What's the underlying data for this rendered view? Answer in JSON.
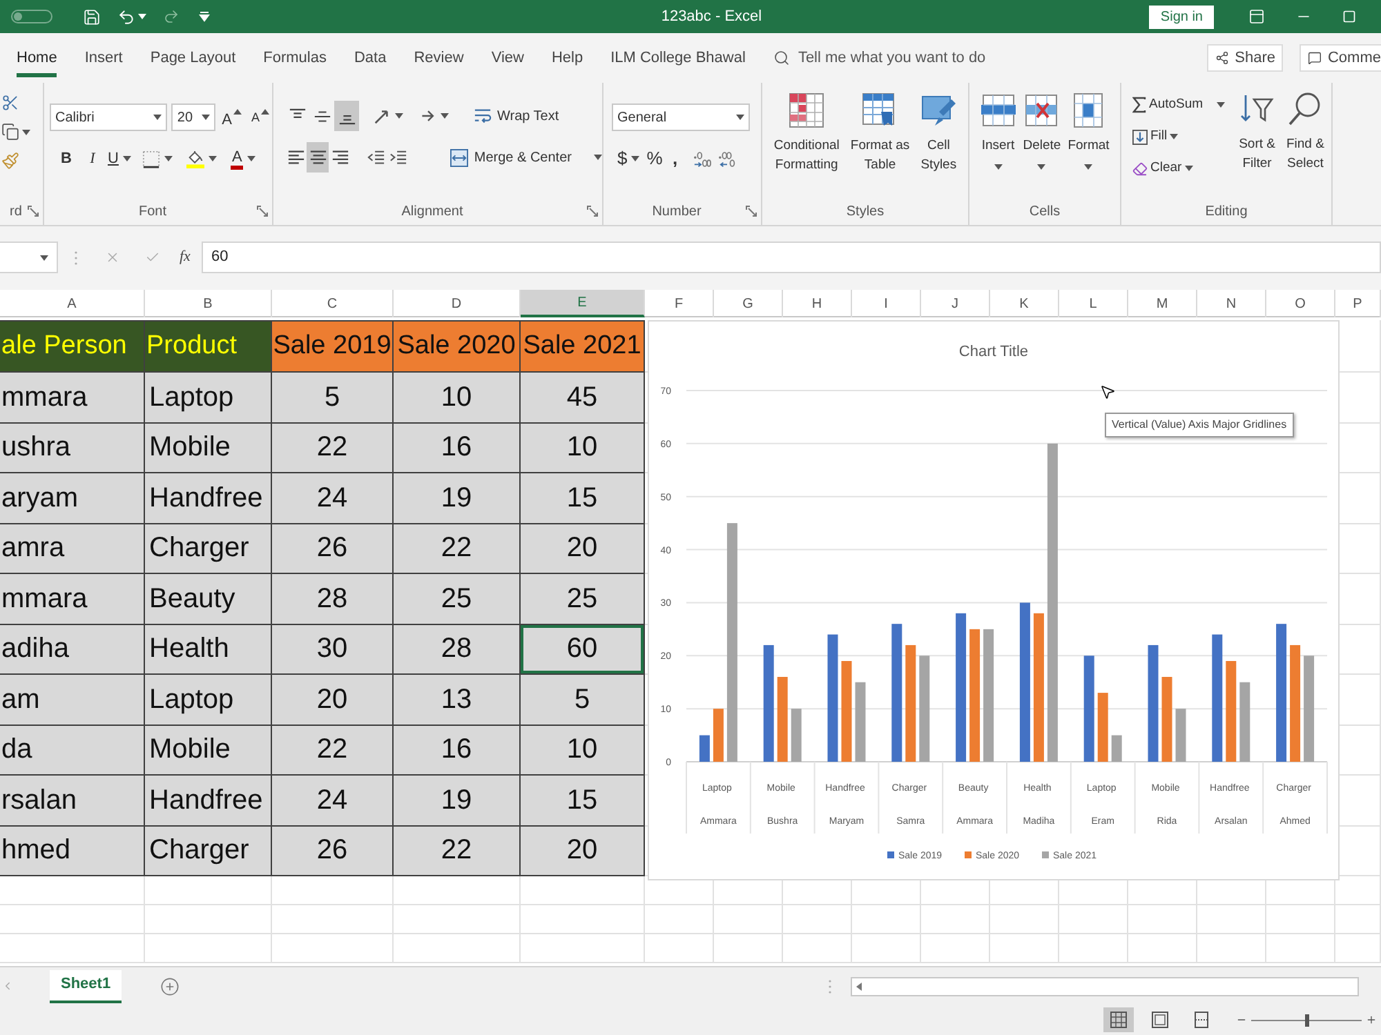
{
  "title_bar": {
    "title": "123abc - Excel",
    "sign_in": "Sign in"
  },
  "tabs": [
    {
      "label": "Home",
      "selected": true
    },
    {
      "label": "Insert",
      "selected": false
    },
    {
      "label": "Page Layout",
      "selected": false
    },
    {
      "label": "Formulas",
      "selected": false
    },
    {
      "label": "Data",
      "selected": false
    },
    {
      "label": "Review",
      "selected": false
    },
    {
      "label": "View",
      "selected": false
    },
    {
      "label": "Help",
      "selected": false
    },
    {
      "label": "ILM College Bhawal",
      "selected": false
    }
  ],
  "tell_me": {
    "placeholder": "Tell me what you want to do"
  },
  "share": "Share",
  "comments": "Comme",
  "ribbon": {
    "clipboard": {
      "label": "rd"
    },
    "font": {
      "label": "Font",
      "font_name": "Calibri",
      "font_size": "20",
      "grow": "A",
      "shrink": "A",
      "bold": "B",
      "italic": "I",
      "underline": "U",
      "font_color": "A"
    },
    "alignment": {
      "label": "Alignment",
      "vertical": [
        {
          "kind": "top",
          "selected": false
        },
        {
          "kind": "middle",
          "selected": false
        },
        {
          "kind": "bottom",
          "selected": true
        }
      ],
      "horizontal": [
        {
          "kind": "left",
          "selected": false
        },
        {
          "kind": "center",
          "selected": true
        },
        {
          "kind": "right",
          "selected": false
        }
      ],
      "wrap_text": "Wrap Text",
      "merge": "Merge & Center"
    },
    "number": {
      "label": "Number",
      "format": "General",
      "currency": "$",
      "percent": "%",
      "comma": ","
    },
    "styles": {
      "label": "Styles",
      "buttons": [
        {
          "kind": "conditional",
          "lines": [
            "Conditional",
            "Formatting"
          ]
        },
        {
          "kind": "table",
          "lines": [
            "Format as",
            "Table"
          ]
        },
        {
          "kind": "cell_styles",
          "lines": [
            "Cell",
            "Styles"
          ]
        }
      ]
    },
    "cells": {
      "label": "Cells",
      "buttons": [
        {
          "kind": "insert",
          "label": "Insert"
        },
        {
          "kind": "delete",
          "label": "Delete"
        },
        {
          "kind": "format",
          "label": "Format"
        }
      ]
    },
    "editing": {
      "label": "Editing",
      "autosum": "AutoSum",
      "fill": "Fill",
      "clear": "Clear",
      "sort": [
        "Sort &",
        "Filter"
      ],
      "find": [
        "Find &",
        "Select"
      ]
    }
  },
  "formula_bar": {
    "function_label": "fx",
    "value": "60"
  },
  "columns": [
    {
      "label": "A",
      "selected": false
    },
    {
      "label": "B",
      "selected": false
    },
    {
      "label": "C",
      "selected": false
    },
    {
      "label": "D",
      "selected": false
    },
    {
      "label": "E",
      "selected": true
    },
    {
      "label": "F",
      "selected": false
    },
    {
      "label": "G",
      "selected": false
    },
    {
      "label": "H",
      "selected": false
    },
    {
      "label": "I",
      "selected": false
    },
    {
      "label": "J",
      "selected": false
    },
    {
      "label": "K",
      "selected": false
    },
    {
      "label": "L",
      "selected": false
    },
    {
      "label": "M",
      "selected": false
    },
    {
      "label": "N",
      "selected": false
    },
    {
      "label": "O",
      "selected": false
    },
    {
      "label": "P",
      "selected": false
    }
  ],
  "table": {
    "header": [
      {
        "text": "ale Person",
        "color": "#375623"
      },
      {
        "text": "Product",
        "color": "#375623"
      },
      {
        "text": "Sale 2019",
        "color": "#ed7d31"
      },
      {
        "text": "Sale 2020",
        "color": "#ed7d31"
      },
      {
        "text": "Sale 2021",
        "color": "#ed7d31"
      }
    ],
    "rows": [
      {
        "cells": [
          {
            "text": "mmara",
            "selected": false
          },
          {
            "text": "Laptop",
            "selected": false
          },
          {
            "text": "5",
            "selected": false
          },
          {
            "text": "10",
            "selected": false
          },
          {
            "text": "45",
            "selected": false
          }
        ]
      },
      {
        "cells": [
          {
            "text": "ushra",
            "selected": false
          },
          {
            "text": "Mobile",
            "selected": false
          },
          {
            "text": "22",
            "selected": false
          },
          {
            "text": "16",
            "selected": false
          },
          {
            "text": "10",
            "selected": false
          }
        ]
      },
      {
        "cells": [
          {
            "text": "aryam",
            "selected": false
          },
          {
            "text": "Handfree",
            "selected": false
          },
          {
            "text": "24",
            "selected": false
          },
          {
            "text": "19",
            "selected": false
          },
          {
            "text": "15",
            "selected": false
          }
        ]
      },
      {
        "cells": [
          {
            "text": "amra",
            "selected": false
          },
          {
            "text": "Charger",
            "selected": false
          },
          {
            "text": "26",
            "selected": false
          },
          {
            "text": "22",
            "selected": false
          },
          {
            "text": "20",
            "selected": false
          }
        ]
      },
      {
        "cells": [
          {
            "text": "mmara",
            "selected": false
          },
          {
            "text": "Beauty",
            "selected": false
          },
          {
            "text": "28",
            "selected": false
          },
          {
            "text": "25",
            "selected": false
          },
          {
            "text": "25",
            "selected": false
          }
        ]
      },
      {
        "cells": [
          {
            "text": "adiha",
            "selected": false
          },
          {
            "text": "Health",
            "selected": false
          },
          {
            "text": "30",
            "selected": false
          },
          {
            "text": "28",
            "selected": false
          },
          {
            "text": "60",
            "selected": true
          }
        ]
      },
      {
        "cells": [
          {
            "text": "am",
            "selected": false
          },
          {
            "text": "Laptop",
            "selected": false
          },
          {
            "text": "20",
            "selected": false
          },
          {
            "text": "13",
            "selected": false
          },
          {
            "text": "5",
            "selected": false
          }
        ]
      },
      {
        "cells": [
          {
            "text": "da",
            "selected": false
          },
          {
            "text": "Mobile",
            "selected": false
          },
          {
            "text": "22",
            "selected": false
          },
          {
            "text": "16",
            "selected": false
          },
          {
            "text": "10",
            "selected": false
          }
        ]
      },
      {
        "cells": [
          {
            "text": "rsalan",
            "selected": false
          },
          {
            "text": "Handfree",
            "selected": false
          },
          {
            "text": "24",
            "selected": false
          },
          {
            "text": "19",
            "selected": false
          },
          {
            "text": "15",
            "selected": false
          }
        ]
      },
      {
        "cells": [
          {
            "text": "hmed",
            "selected": false
          },
          {
            "text": "Charger",
            "selected": false
          },
          {
            "text": "26",
            "selected": false
          },
          {
            "text": "22",
            "selected": false
          },
          {
            "text": "20",
            "selected": false
          }
        ]
      }
    ]
  },
  "chart": {
    "tooltip": "Vertical (Value) Axis Major Gridlines",
    "chart_data": {
      "type": "bar",
      "title": "Chart Title",
      "categories": [
        "Laptop\nAmmara",
        "Mobile\nBushra",
        "Handfree\nMaryam",
        "Charger\nSamra",
        "Beauty\nAmmara",
        "Health\nMadiha",
        "Laptop\nEram",
        "Mobile\nRida",
        "Handfree\nArsalan",
        "Charger\nAhmed"
      ],
      "series": [
        {
          "name": "Sale 2019",
          "color": "#4472c4",
          "values": [
            5,
            22,
            24,
            26,
            28,
            30,
            20,
            22,
            24,
            26
          ]
        },
        {
          "name": "Sale 2020",
          "color": "#ed7d31",
          "values": [
            10,
            16,
            19,
            22,
            25,
            28,
            13,
            16,
            19,
            22
          ]
        },
        {
          "name": "Sale 2021",
          "color": "#a5a5a5",
          "values": [
            45,
            10,
            15,
            20,
            25,
            60,
            5,
            10,
            15,
            20
          ]
        }
      ],
      "ylim": [
        0,
        70
      ],
      "yticks": [
        0,
        10,
        20,
        30,
        40,
        50,
        60,
        70
      ],
      "grid": true,
      "legend": "bottom"
    }
  },
  "sheet_tabs": [
    {
      "label": "Sheet1",
      "selected": true
    }
  ],
  "status_bar": {
    "views": [
      {
        "kind": "normal",
        "selected": true
      },
      {
        "kind": "page_layout",
        "selected": false
      },
      {
        "kind": "page_break",
        "selected": false
      }
    ],
    "zoom": {
      "level": 0.5
    }
  }
}
